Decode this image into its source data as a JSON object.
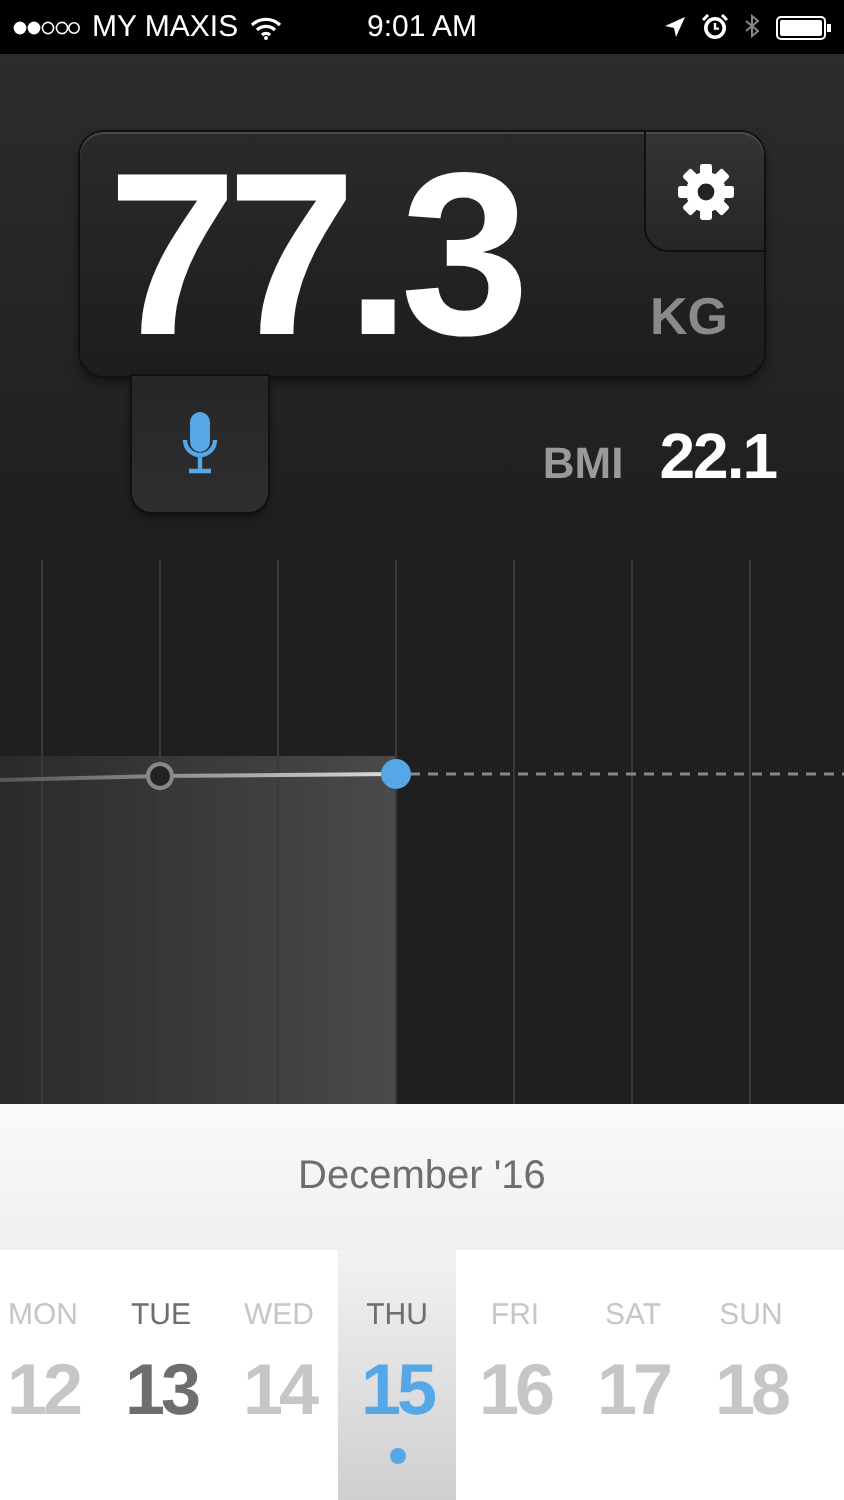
{
  "status_bar": {
    "carrier": "MY MAXIS",
    "time": "9:01 AM"
  },
  "weight": {
    "value": "77.3",
    "unit": "KG"
  },
  "bmi": {
    "label": "BMI",
    "value": "22.1"
  },
  "calendar": {
    "month": "December '16",
    "days": [
      {
        "name": "MON",
        "number": "12",
        "logged": false,
        "selected": false
      },
      {
        "name": "TUE",
        "number": "13",
        "logged": true,
        "selected": false
      },
      {
        "name": "WED",
        "number": "14",
        "logged": false,
        "selected": false
      },
      {
        "name": "THU",
        "number": "15",
        "logged": true,
        "selected": true
      },
      {
        "name": "FRI",
        "number": "16",
        "logged": false,
        "selected": false
      },
      {
        "name": "SAT",
        "number": "17",
        "logged": false,
        "selected": false
      },
      {
        "name": "SUN",
        "number": "18",
        "logged": false,
        "selected": false
      }
    ]
  }
}
